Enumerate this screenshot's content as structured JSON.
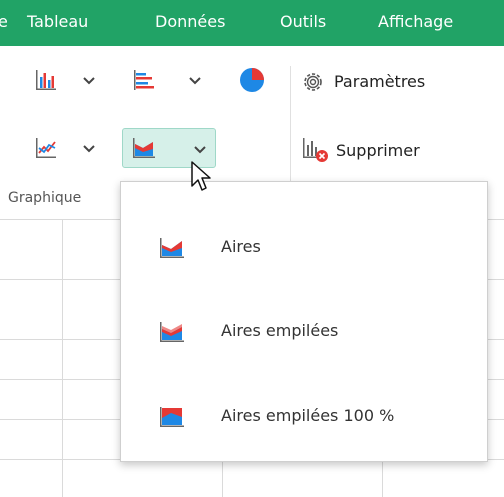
{
  "menubar": {
    "items": [
      {
        "label": "e"
      },
      {
        "label": "Tableau"
      },
      {
        "label": "Données"
      },
      {
        "label": "Outils"
      },
      {
        "label": "Affichage"
      }
    ]
  },
  "ribbon": {
    "settings_label": "Paramètres",
    "delete_label": "Supprimer",
    "group_label": "Graphique"
  },
  "dropdown": {
    "items": [
      {
        "label": "Aires"
      },
      {
        "label": "Aires empilées"
      },
      {
        "label": "Aires empilées 100 %"
      }
    ]
  },
  "colors": {
    "menubar_bg": "#21a366",
    "accent_blue": "#1e88e5",
    "accent_red": "#e53935",
    "selected_bg": "#d6f0e9"
  },
  "icons": [
    "bar-chart-icon",
    "horizontal-bar-chart-icon",
    "pie-chart-icon",
    "line-chart-icon",
    "area-chart-icon",
    "gear-icon",
    "delete-chart-icon",
    "chevron-down-icon",
    "mouse-cursor-icon"
  ]
}
